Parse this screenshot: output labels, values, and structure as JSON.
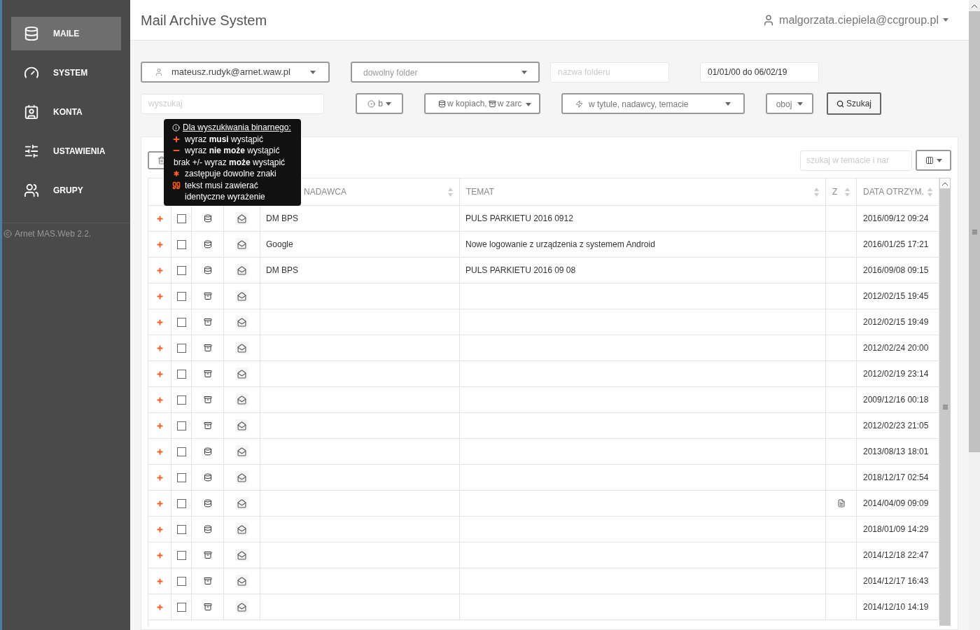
{
  "sidebar": {
    "items": [
      {
        "label": "MAILE",
        "selected": true
      },
      {
        "label": "SYSTEM",
        "selected": false
      },
      {
        "label": "KONTA",
        "selected": false
      },
      {
        "label": "USTAWIENIA",
        "selected": false
      },
      {
        "label": "GRUPY",
        "selected": false
      }
    ],
    "footer": "Arnet MAS.Web 2.2."
  },
  "header": {
    "title": "Mail Archive System",
    "user": "malgorzata.ciepiela@ccgroup.pl"
  },
  "filters": {
    "account": "mateusz.rudyk@arnet.waw.pl",
    "folder": "dowolny folder",
    "folder_name_placeholder": "nazwa folderu",
    "date_range": "01/01/00 do 06/02/19",
    "search_placeholder": "wyszukaj",
    "mode": "b",
    "sources": [
      {
        "kind": "copy",
        "label": "w kopiach,"
      },
      {
        "kind": "archive",
        "label": "w zarc"
      }
    ],
    "scope": "w tytule, nadawcy, temacie",
    "direction": "oboj",
    "search_button": "Szukaj"
  },
  "tooltip": {
    "title": "Dla wyszukiwania binarnego:",
    "lines": [
      {
        "kind": "plus",
        "text": "wyraz **musi** wystąpić"
      },
      {
        "kind": "minus",
        "text": "wyraz **nie może** wystąpić"
      },
      {
        "kind": "none",
        "text": "brak +/- wyraz **może** wystąpić"
      },
      {
        "kind": "asterisk",
        "text": "zastępuje dowolne znaki"
      },
      {
        "kind": "quote",
        "text": "tekst musi zawierać identyczne wyrażenie"
      }
    ]
  },
  "table": {
    "filter_placeholder": "szukaj w temacie i nar",
    "columns": [
      "NADAWCA",
      "TEMAT",
      "Z",
      "DATA OTRZYM."
    ],
    "rows": [
      {
        "kind": "copy",
        "checked": false,
        "sender": "DM BPS",
        "subject": "PULS PARKIETU 2016 0912",
        "attachment": false,
        "date": "2016/09/12 09:24"
      },
      {
        "kind": "copy",
        "checked": false,
        "sender": "Google",
        "subject": "Nowe logowanie z urządzenia z systemem Android",
        "attachment": false,
        "date": "2016/01/25 17:21"
      },
      {
        "kind": "copy",
        "checked": false,
        "sender": "DM BPS",
        "subject": "PULS PARKIETU 2016 09 08",
        "attachment": false,
        "date": "2016/09/08 09:15"
      },
      {
        "kind": "archive",
        "checked": false,
        "attachment": false,
        "date": "2012/02/15 19:45"
      },
      {
        "kind": "archive",
        "checked": false,
        "attachment": false,
        "date": "2012/02/15 19:49"
      },
      {
        "kind": "archive",
        "checked": false,
        "attachment": false,
        "date": "2012/02/24 20:00"
      },
      {
        "kind": "archive",
        "checked": false,
        "attachment": false,
        "date": "2012/02/19 23:14"
      },
      {
        "kind": "archive",
        "checked": false,
        "attachment": false,
        "date": "2009/12/16 00:18"
      },
      {
        "kind": "archive",
        "checked": false,
        "attachment": false,
        "date": "2012/02/23 21:05"
      },
      {
        "kind": "copy",
        "checked": false,
        "attachment": false,
        "date": "2013/08/13 18:01"
      },
      {
        "kind": "copy",
        "checked": false,
        "attachment": false,
        "date": "2018/12/17 02:54"
      },
      {
        "kind": "copy",
        "checked": false,
        "attachment": true,
        "date": "2014/04/09 09:09"
      },
      {
        "kind": "copy",
        "checked": false,
        "attachment": false,
        "date": "2018/01/09 14:29"
      },
      {
        "kind": "archive",
        "checked": false,
        "attachment": false,
        "date": "2014/12/18 22:47"
      },
      {
        "kind": "archive",
        "checked": false,
        "attachment": false,
        "date": "2014/12/17 16:43"
      },
      {
        "kind": "archive",
        "checked": false,
        "attachment": false,
        "date": "2014/12/10 14:19"
      }
    ]
  }
}
